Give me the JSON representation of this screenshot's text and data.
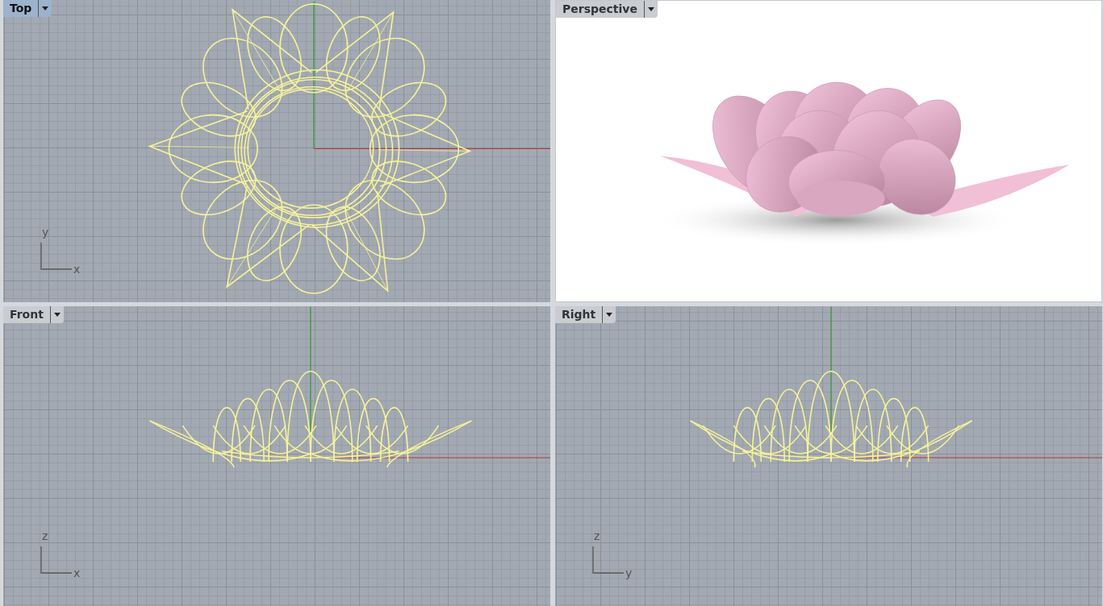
{
  "viewports": [
    {
      "title": "Top",
      "selected": true,
      "kind": "wire-top",
      "axes": {
        "horizontal": "x",
        "vertical": "y"
      }
    },
    {
      "title": "Perspective",
      "selected": false,
      "kind": "rendered"
    },
    {
      "title": "Front",
      "selected": false,
      "kind": "wire-front",
      "axes": {
        "horizontal": "x",
        "vertical": "z"
      }
    },
    {
      "title": "Right",
      "selected": false,
      "kind": "wire-right",
      "axes": {
        "horizontal": "y",
        "vertical": "z"
      }
    }
  ]
}
